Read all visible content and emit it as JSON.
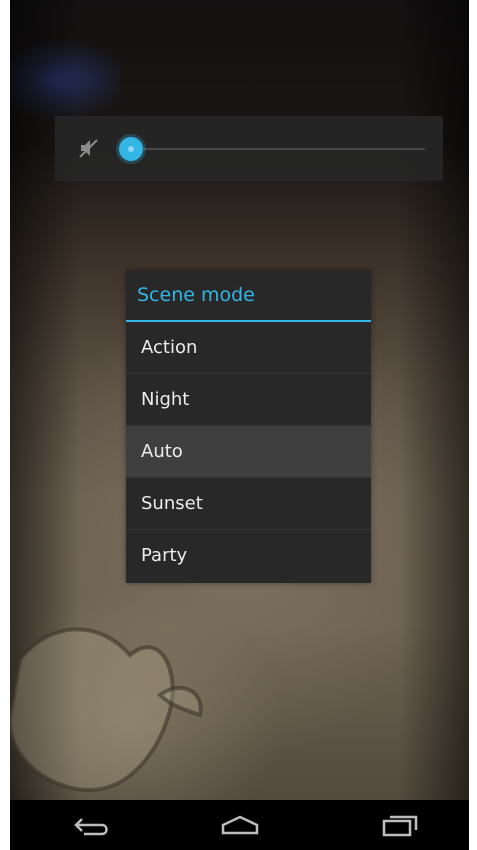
{
  "slider": {
    "icon": "volume-mute-icon",
    "level": 0.0,
    "accent_color": "#33b5e5"
  },
  "scene_dialog": {
    "title": "Scene mode",
    "options": [
      {
        "label": "Action",
        "selected": false
      },
      {
        "label": "Night",
        "selected": false
      },
      {
        "label": "Auto",
        "selected": true
      },
      {
        "label": "Sunset",
        "selected": false
      },
      {
        "label": "Party",
        "selected": false
      }
    ]
  },
  "navbar": {
    "icons": [
      "back-icon",
      "home-icon",
      "recent-apps-icon"
    ]
  }
}
